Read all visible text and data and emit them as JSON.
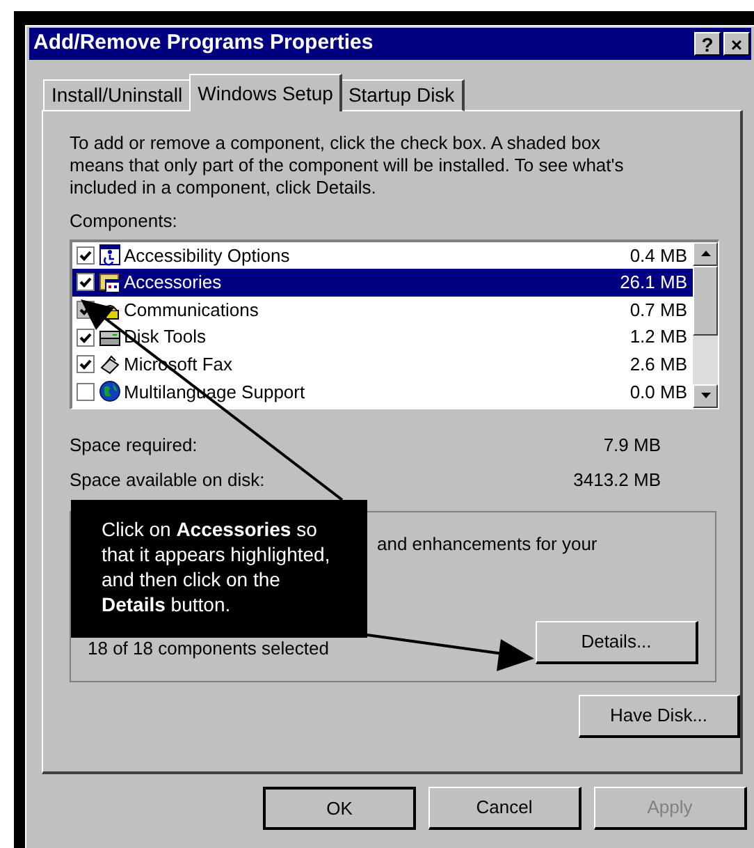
{
  "window": {
    "title": "Add/Remove Programs Properties",
    "title_buttons": [
      "?",
      "×"
    ]
  },
  "tabs": [
    {
      "label": "Install/Uninstall",
      "selected": false
    },
    {
      "label": "Windows Setup",
      "selected": true
    },
    {
      "label": "Startup Disk",
      "selected": false
    }
  ],
  "intro": "To add or remove a component, click the check box. A shaded box means that only part of the component will be installed. To see what's included in a component, click Details.",
  "components_label": "Components:",
  "components": [
    {
      "name": "Accessibility Options",
      "size": "0.4 MB",
      "checked": true,
      "partial": false,
      "selected": false
    },
    {
      "name": "Accessories",
      "size": "26.1 MB",
      "checked": true,
      "partial": false,
      "selected": true
    },
    {
      "name": "Communications",
      "size": "0.7 MB",
      "checked": true,
      "partial": true,
      "selected": false
    },
    {
      "name": "Disk Tools",
      "size": "1.2 MB",
      "checked": true,
      "partial": false,
      "selected": false
    },
    {
      "name": "Microsoft Fax",
      "size": "2.6 MB",
      "checked": true,
      "partial": false,
      "selected": false
    },
    {
      "name": "Multilanguage Support",
      "size": "0.0 MB",
      "checked": false,
      "partial": false,
      "selected": false
    }
  ],
  "space": [
    {
      "label": "Space required:",
      "value": "7.9 MB"
    },
    {
      "label": "Space available on disk:",
      "value": "3413.2 MB"
    }
  ],
  "description": {
    "text": "and enhancements for your",
    "summary": "18 of 18 components selected",
    "details_button": "Details..."
  },
  "have_disk_button": "Have Disk...",
  "buttons": [
    {
      "label": "OK",
      "disabled": false,
      "default": true
    },
    {
      "label": "Cancel",
      "disabled": false,
      "default": false
    },
    {
      "label": "Apply",
      "disabled": true,
      "default": false
    }
  ],
  "callout": "Click on **Accessories** so that it appears highlighted, and then click on the **Details** button."
}
